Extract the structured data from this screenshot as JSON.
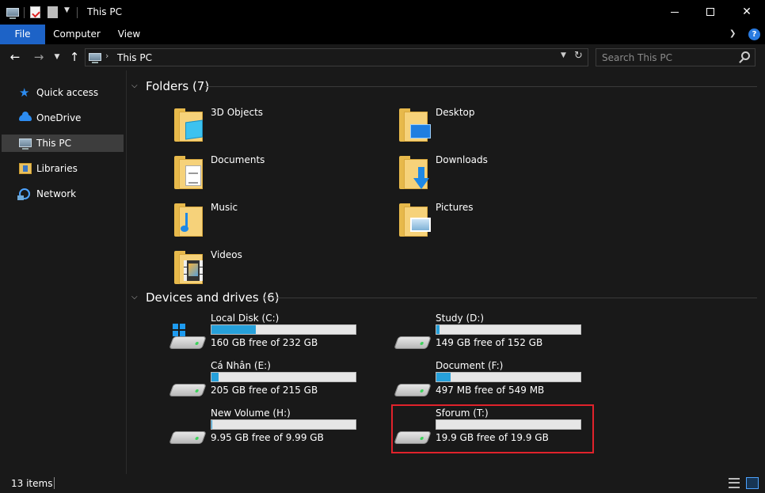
{
  "window": {
    "title": "This PC"
  },
  "ribbon": {
    "tabs": [
      "File",
      "Computer",
      "View"
    ]
  },
  "address": {
    "path": "This PC",
    "search_placeholder": "Search This PC"
  },
  "sidebar": {
    "items": [
      {
        "label": "Quick access",
        "icon": "star-icon"
      },
      {
        "label": "OneDrive",
        "icon": "cloud-icon"
      },
      {
        "label": "This PC",
        "icon": "computer-icon",
        "selected": true
      },
      {
        "label": "Libraries",
        "icon": "libraries-icon"
      },
      {
        "label": "Network",
        "icon": "network-icon"
      }
    ]
  },
  "folders": {
    "title": "Folders (7)",
    "items": [
      {
        "label": "3D Objects",
        "icon": "3d-objects-folder-icon"
      },
      {
        "label": "Desktop",
        "icon": "desktop-folder-icon"
      },
      {
        "label": "Documents",
        "icon": "documents-folder-icon"
      },
      {
        "label": "Downloads",
        "icon": "downloads-folder-icon"
      },
      {
        "label": "Music",
        "icon": "music-folder-icon"
      },
      {
        "label": "Pictures",
        "icon": "pictures-folder-icon"
      },
      {
        "label": "Videos",
        "icon": "videos-folder-icon"
      }
    ]
  },
  "drives": {
    "title": "Devices and drives (6)",
    "items": [
      {
        "label": "Local Disk (C:)",
        "free": "160 GB free of 232 GB",
        "used_fraction": 0.31,
        "system": true
      },
      {
        "label": "Study (D:)",
        "free": "149 GB free of 152 GB",
        "used_fraction": 0.02
      },
      {
        "label": "Cá Nhân (E:)",
        "free": "205 GB free of 215 GB",
        "used_fraction": 0.05
      },
      {
        "label": "Document (F:)",
        "free": "497 MB free of 549 MB",
        "used_fraction": 0.1
      },
      {
        "label": "New Volume (H:)",
        "free": "9.95 GB free of 9.99 GB",
        "used_fraction": 0.005
      },
      {
        "label": "Sforum (T:)",
        "free": "19.9 GB free of 19.9 GB",
        "used_fraction": 0.0,
        "highlighted": true
      }
    ]
  },
  "status": {
    "item_count": "13 items"
  },
  "colors": {
    "accent": "#1d63c7",
    "drive_bar_fill": "#26a0da",
    "highlight": "#e0222b"
  }
}
